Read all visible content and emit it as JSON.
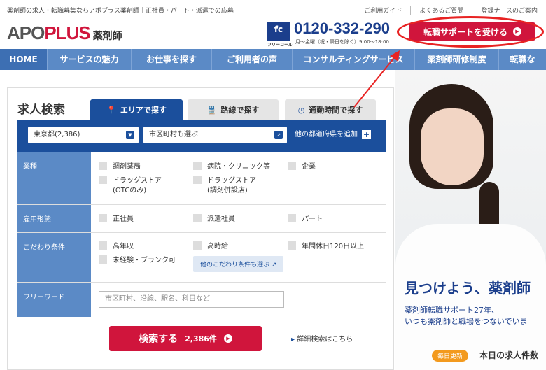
{
  "header": {
    "tagline": "薬剤師の求人・転職募集ならアポプラス薬剤師｜正社員・パート・派遣での応募",
    "top_links": [
      "ご利用ガイド",
      "よくあるご質問",
      "登録ナースのご案内"
    ],
    "logo_main": "APO",
    "logo_plus": "PLUS",
    "logo_sub": "薬剤師",
    "freecall_badge": "fc",
    "freecall_label": "フリーコール",
    "phone": "0120-332-290",
    "hours": "月〜金曜（祝・祭日を除く）9:00〜18:00",
    "cta_label": "転職サポートを受ける"
  },
  "nav": {
    "items": [
      "HOME",
      "サービスの魅力",
      "お仕事を探す",
      "ご利用者の声",
      "コンサルティングサービス",
      "薬剤師研修制度",
      "転職な"
    ]
  },
  "search": {
    "title": "求人検索",
    "tabs": [
      "エリアで探す",
      "路線で探す",
      "通勤時間で探す"
    ],
    "prefecture_value": "東京都(2,386)",
    "city_placeholder": "市区町村も選ぶ",
    "add_prefecture": "他の都道府県を追加",
    "rows": {
      "industry": {
        "label": "業種",
        "options": [
          "調剤薬局",
          "病院・クリニック等",
          "企業",
          "ドラッグストア",
          "ドラッグストア"
        ],
        "option_notes": [
          "(OTCのみ)",
          "(調剤併設店)"
        ]
      },
      "employment": {
        "label": "雇用形態",
        "options": [
          "正社員",
          "派遣社員",
          "パート"
        ]
      },
      "conditions": {
        "label": "こだわり条件",
        "options": [
          "高年収",
          "高時給",
          "年間休日120日以上",
          "未経験・ブランク可"
        ],
        "more": "他のこだわり条件も選ぶ"
      },
      "freeword": {
        "label": "フリーワード",
        "placeholder": "市区町村、沿線、駅名、科目など"
      }
    },
    "submit_label": "検索する",
    "submit_count": "2,386件",
    "detail_link": "詳細検索はこちら"
  },
  "hero": {
    "title": "見つけよう、薬剤師",
    "sub_line1": "薬剤師転職サポート27年、",
    "sub_line2": "いつも薬剤師と職場をつないでいま",
    "daily_badge": "毎日更新",
    "count_label": "本日の求人件数"
  },
  "colors": {
    "brand_red": "#d0153c",
    "navy": "#1b4f9c",
    "nav_blue": "#5b8ac6",
    "annotation_red": "#e82323"
  }
}
